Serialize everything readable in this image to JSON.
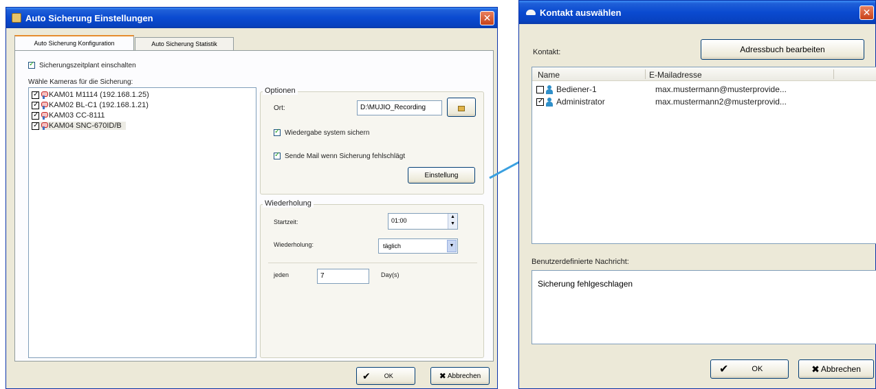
{
  "left_window": {
    "title": "Auto Sicherung Einstellungen",
    "close_glyph": "✕",
    "tabs": [
      {
        "label": "Auto Sicherung Konfiguration",
        "active": true
      },
      {
        "label": "Auto Sicherung Statistik",
        "active": false
      }
    ],
    "enable_schedule": {
      "label": "Sicherungszeitplant einschalten",
      "checked": true
    },
    "camera_list_label": "Wähle Kameras für die Sicherung:",
    "cameras": [
      {
        "label": "KAM01 M1114 (192.168.1.25)",
        "checked": true
      },
      {
        "label": "KAM02 BL-C1 (192.168.1.21)",
        "checked": true
      },
      {
        "label": "KAM03 CC-8111",
        "checked": true
      },
      {
        "label": "KAM04 SNC-670ID/B",
        "checked": true
      }
    ],
    "options": {
      "group_label": "Optionen",
      "location_label": "Ort:",
      "location_value": "D:\\MUJIO_Recording",
      "backup_playback": {
        "label": "Wiedergabe system sichern",
        "checked": true
      },
      "send_mail": {
        "label": "Sende Mail wenn Sicherung fehlschlägt",
        "checked": true
      },
      "settings_button": "Einstellung"
    },
    "repeat": {
      "group_label": "Wiederholung",
      "start_label": "Startzeit:",
      "start_value": "01:00",
      "repeat_label": "Wiederholung:",
      "repeat_value": "täglich",
      "every_label": "jeden",
      "every_value": "7",
      "unit_label": "Day(s)"
    },
    "ok_button": "OK",
    "cancel_button": "Abbrechen"
  },
  "right_window": {
    "title": "Kontakt auswählen",
    "close_glyph": "✕",
    "contact_label": "Kontakt:",
    "edit_addressbook_button": "Adressbuch bearbeiten",
    "columns": [
      "Name",
      "E-Mailadresse"
    ],
    "contacts": [
      {
        "name": "Bediener-1",
        "email": "max.mustermann@musterprovide...",
        "checked": false
      },
      {
        "name": "Administrator",
        "email": "max.mustermann2@musterprovid...",
        "checked": true
      }
    ],
    "message_label": "Benutzerdefinierte Nachricht:",
    "message_value": "Sicherung fehlgeschlagen",
    "ok_button": "OK",
    "cancel_button": "Abbrechen"
  },
  "colors": {
    "titlebar": "#0a4ad0",
    "dialog_bg": "#ece9d8",
    "connector": "#3aa0e0",
    "close_button": "#c84218"
  }
}
